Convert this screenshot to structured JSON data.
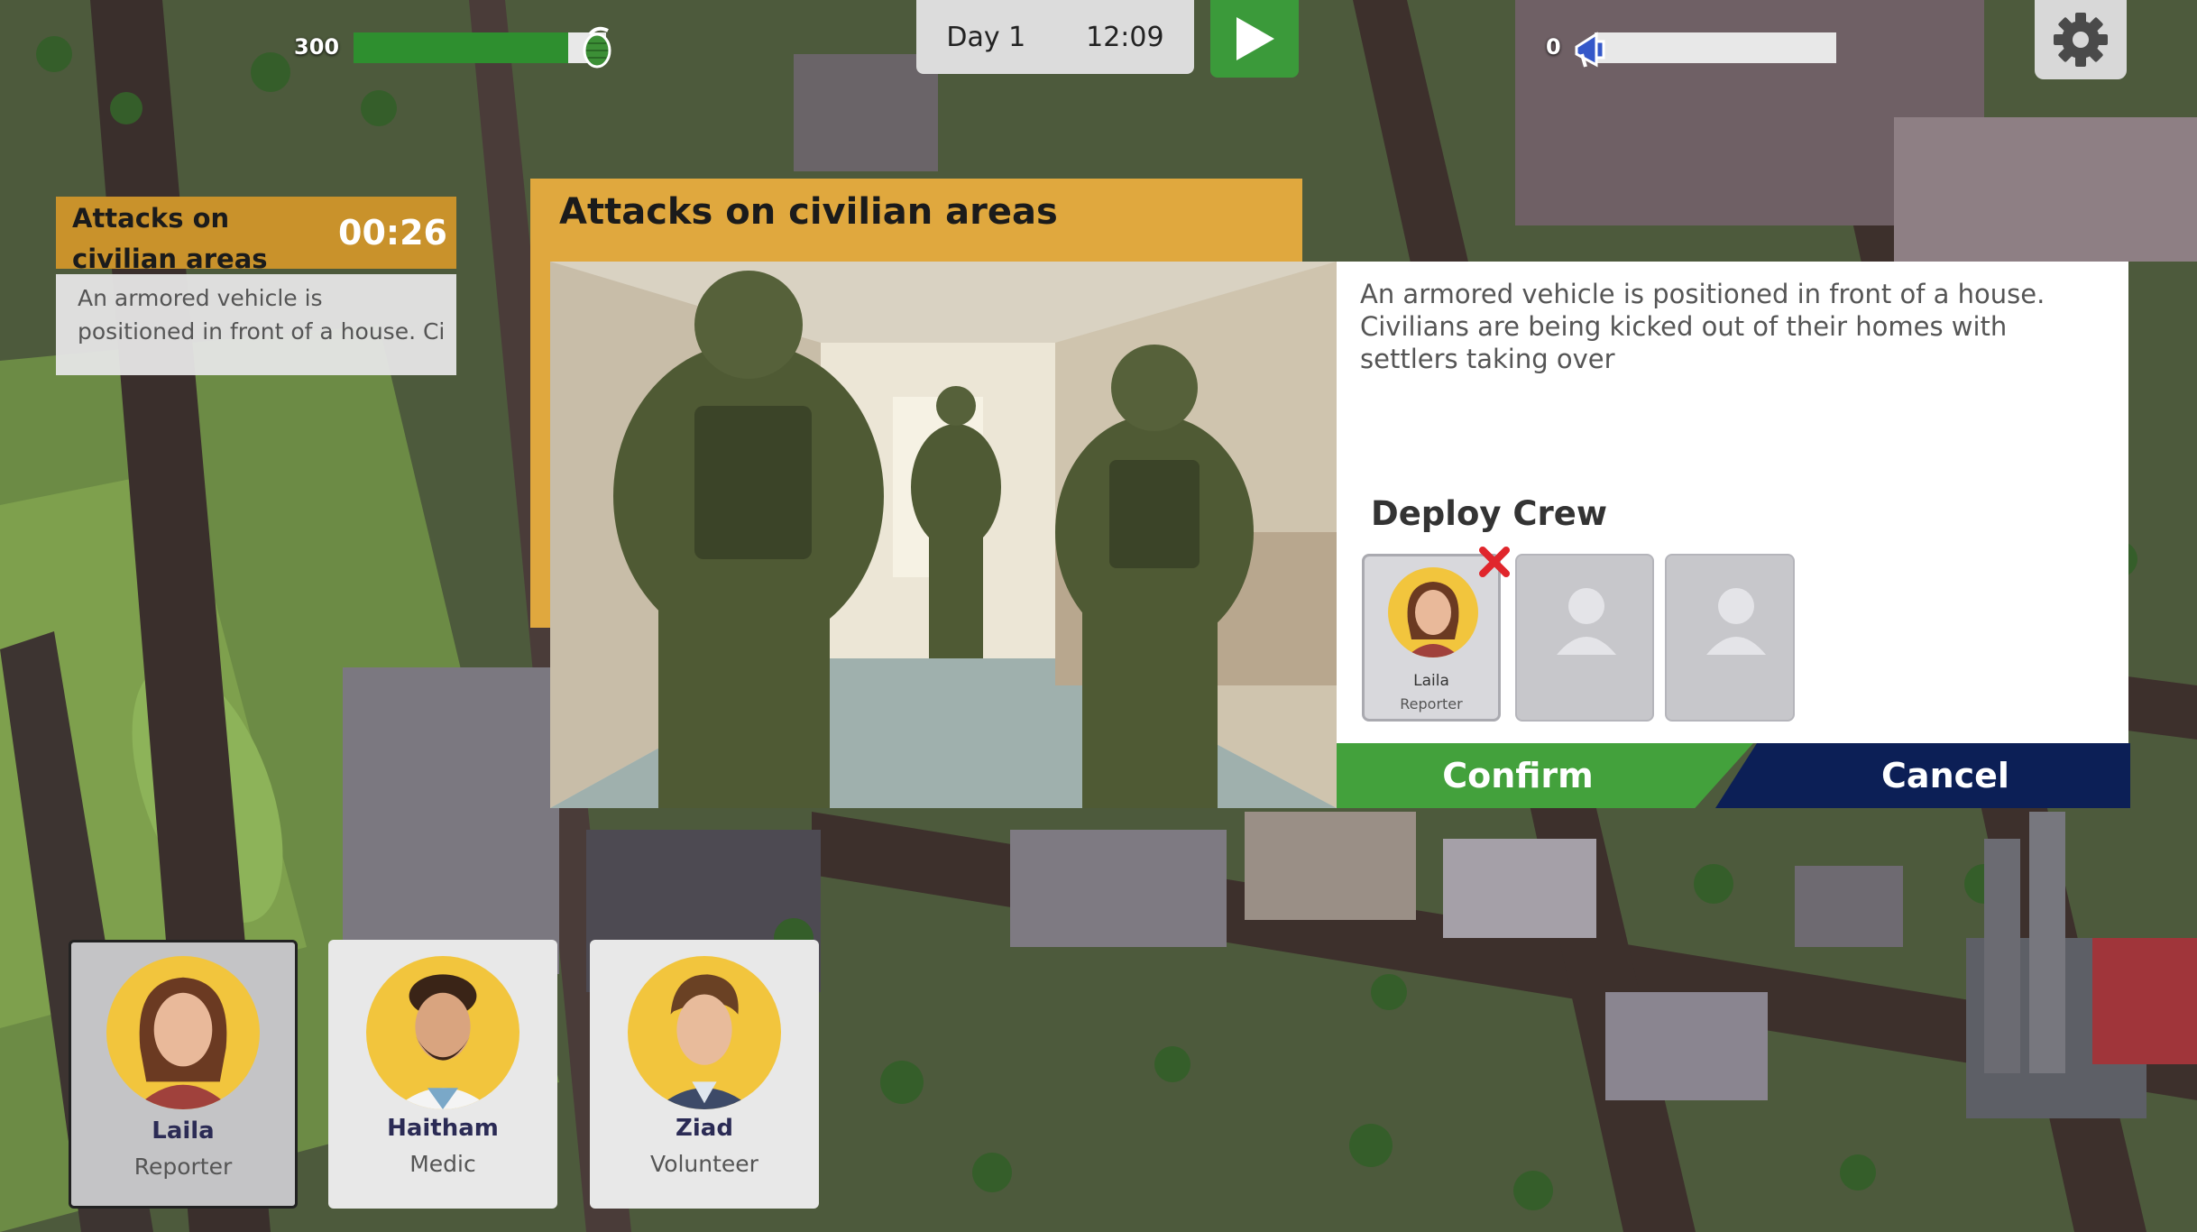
{
  "hud": {
    "left_counter": "300",
    "left_progress": 0.85,
    "left_icon": "grenade-icon",
    "day": "Day 1",
    "time": "12:09",
    "play_icon": "play-icon",
    "right_counter": "0",
    "right_progress": 0.0,
    "right_icon": "megaphone-icon",
    "settings_icon": "gear-icon"
  },
  "event_card": {
    "title": "Attacks on civilian areas",
    "timer": "00:26",
    "preview_line1": "An armored vehicle is",
    "preview_line2": "positioned in front of a house. Ci"
  },
  "modal": {
    "title": "Attacks on civilian areas",
    "description": "An armored vehicle is positioned in front of a house. Civilians are being kicked out of their homes with settlers taking over",
    "deploy_title": "Deploy Crew",
    "slots": [
      {
        "name": "Laila",
        "role": "Reporter",
        "filled": true
      },
      {
        "filled": false
      },
      {
        "filled": false
      }
    ],
    "confirm_label": "Confirm",
    "cancel_label": "Cancel"
  },
  "crew": [
    {
      "name": "Laila",
      "role": "Reporter",
      "selected": true
    },
    {
      "name": "Haitham",
      "role": "Medic",
      "selected": false
    },
    {
      "name": "Ziad",
      "role": "Volunteer",
      "selected": false
    }
  ],
  "colors": {
    "accent_orange": "#e0a83e",
    "confirm_green": "#43a13c",
    "cancel_navy": "#0c1f56",
    "avatar_yellow": "#f2c53d",
    "progress_green": "#2e8f2f",
    "progress_blue": "#3558c9"
  }
}
